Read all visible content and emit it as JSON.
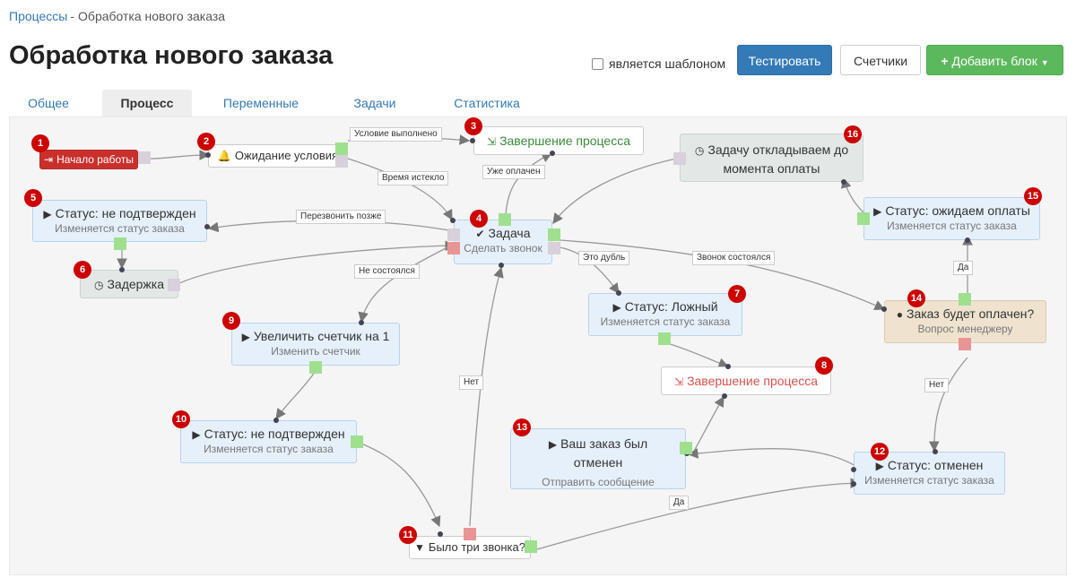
{
  "breadcrumb": {
    "parent": "Процессы",
    "separator": "-",
    "current": "Обработка нового заказа"
  },
  "title": "Обработка нового заказа",
  "template_checkbox": {
    "label": "является шаблоном",
    "checked": false
  },
  "buttons": {
    "test": "Тестировать",
    "counters": "Счетчики",
    "add_block": "Добавить блок"
  },
  "tabs": [
    {
      "label": "Общее",
      "active": false
    },
    {
      "label": "Процесс",
      "active": true
    },
    {
      "label": "Переменные",
      "active": false
    },
    {
      "label": "Задачи",
      "active": false
    },
    {
      "label": "Статистика",
      "active": false
    }
  ],
  "colors": {
    "primary": "#337ab7",
    "success": "#5cb85c",
    "badge": "#cc0000",
    "port_ok": "#9fe08f",
    "port_fail": "#e89595"
  },
  "nodes": {
    "n1": {
      "num": "1",
      "icon": "sign-in-icon",
      "title": "Начало работы"
    },
    "n2": {
      "num": "2",
      "icon": "bell-icon",
      "title": "Ожидание условия"
    },
    "n3": {
      "num": "3",
      "icon": "sign-out-icon",
      "title": "Завершение процесса"
    },
    "n4": {
      "num": "4",
      "icon": "check-icon",
      "title": "Задача",
      "subtitle": "Сделать звонок"
    },
    "n5": {
      "num": "5",
      "icon": "play-icon",
      "title": "Статус: не подтвержден",
      "subtitle": "Изменяется статус заказа"
    },
    "n6": {
      "num": "6",
      "icon": "clock-icon",
      "title": "Задержка"
    },
    "n7": {
      "num": "7",
      "icon": "play-icon",
      "title": "Статус: Ложный",
      "subtitle": "Изменяется статус заказа"
    },
    "n8": {
      "num": "8",
      "icon": "sign-out-icon",
      "title": "Завершение процесса"
    },
    "n9": {
      "num": "9",
      "icon": "play-icon",
      "title": "Увеличить счетчик на 1",
      "subtitle": "Изменить счетчик"
    },
    "n10": {
      "num": "10",
      "icon": "play-icon",
      "title": "Статус: не подтвержден",
      "subtitle": "Изменяется статус заказа"
    },
    "n11": {
      "num": "11",
      "icon": "filter-icon",
      "title": "Было три звонка?"
    },
    "n12": {
      "num": "12",
      "icon": "play-icon",
      "title": "Статус: отменен",
      "subtitle": "Изменяется статус заказа"
    },
    "n13": {
      "num": "13",
      "icon": "play-icon",
      "title_l1": "Ваш заказ был",
      "title_l2": "отменен",
      "subtitle": "Отправить сообщение"
    },
    "n14": {
      "num": "14",
      "icon": "user-icon",
      "title": "Заказ будет оплачен?",
      "subtitle": "Вопрос менеджеру"
    },
    "n15": {
      "num": "15",
      "icon": "play-icon",
      "title": "Статус: ожидаем оплаты",
      "subtitle": "Изменяется статус заказа"
    },
    "n16": {
      "num": "16",
      "icon": "clock-icon",
      "title_l1": "Задачу откладываем до",
      "title_l2": "момента оплаты"
    }
  },
  "link_labels": {
    "condition_met": "Условие выполнено",
    "time_expired": "Время истекло",
    "already_paid": "Уже оплачен",
    "call_later": "Перезвонить позже",
    "not_held": "Не состоялся",
    "duplicate": "Это дубль",
    "call_held": "Звонок состоялся",
    "no_1": "Нет",
    "no_2": "Нет",
    "yes_1": "Да",
    "yes_2": "Да"
  }
}
